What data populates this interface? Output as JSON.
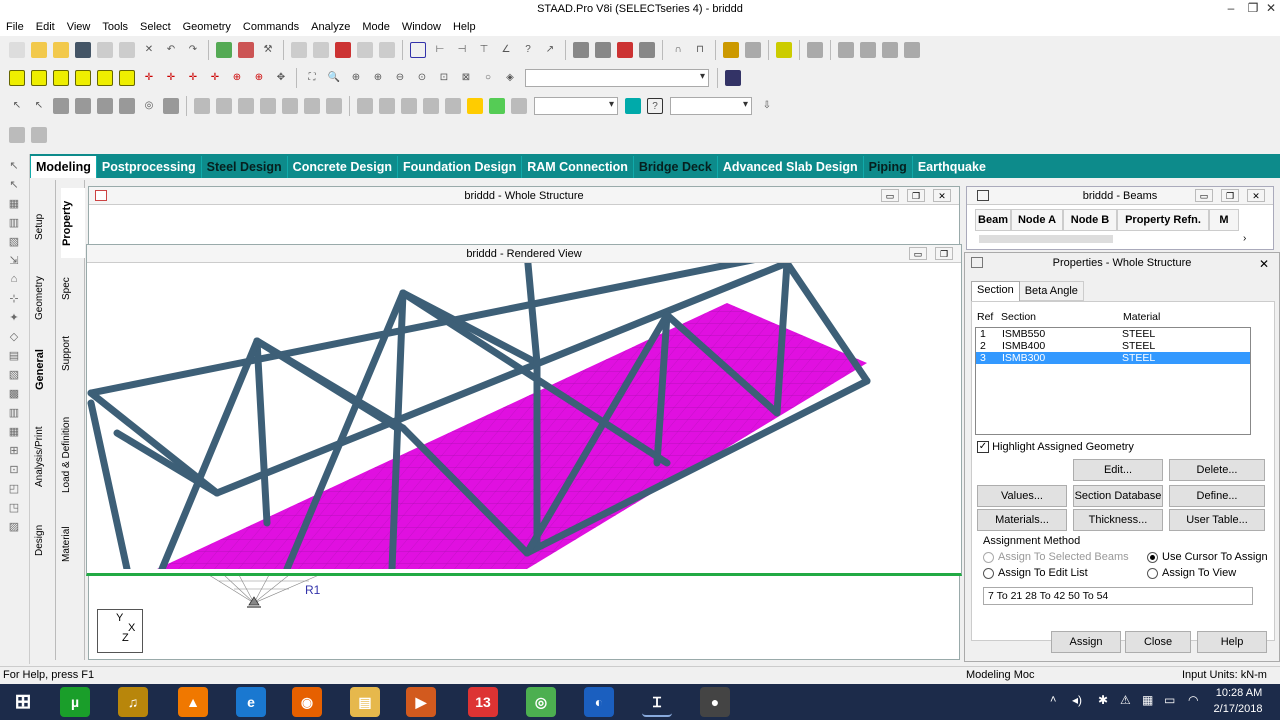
{
  "window": {
    "title": "STAAD.Pro V8i (SELECTseries 4) - briddd"
  },
  "menu": [
    "File",
    "Edit",
    "View",
    "Tools",
    "Select",
    "Geometry",
    "Commands",
    "Analyze",
    "Mode",
    "Window",
    "Help"
  ],
  "page_tabs": [
    "Modeling",
    "Postprocessing",
    "Steel Design",
    "Concrete Design",
    "Foundation Design",
    "RAM Connection",
    "Bridge Deck",
    "Advanced Slab Design",
    "Piping",
    "Earthquake"
  ],
  "side_tabs_outer": [
    "Setup",
    "Geometry",
    "General",
    "Analysis/Print",
    "Design"
  ],
  "side_tabs_inner": [
    "Property",
    "Spec",
    "Support",
    "Load & Definition",
    "Material"
  ],
  "whole_structure": {
    "title": "briddd - Whole Structure",
    "node_label": "R1",
    "axes": {
      "y": "Y",
      "x": "X",
      "z": "Z"
    }
  },
  "rendered_view": {
    "title": "briddd - Rendered View"
  },
  "beams_table": {
    "title": "briddd - Beams",
    "columns": [
      "Beam",
      "Node A",
      "Node B",
      "Property Refn.",
      "M"
    ]
  },
  "properties": {
    "title": "Properties - Whole Structure",
    "tabs": [
      "Section",
      "Beta Angle"
    ],
    "list_headers": {
      "ref": "Ref",
      "section": "Section",
      "material": "Material"
    },
    "rows": [
      {
        "ref": "1",
        "section": "ISMB550",
        "material": "STEEL"
      },
      {
        "ref": "2",
        "section": "ISMB400",
        "material": "STEEL"
      },
      {
        "ref": "3",
        "section": "ISMB300",
        "material": "STEEL"
      }
    ],
    "highlight_label": "Highlight Assigned Geometry",
    "buttons": {
      "edit": "Edit...",
      "delete": "Delete...",
      "values": "Values...",
      "section_db": "Section Database",
      "define": "Define...",
      "materials": "Materials...",
      "thickness": "Thickness...",
      "user_table": "User Table...",
      "assign": "Assign",
      "close": "Close",
      "help": "Help"
    },
    "assignment": {
      "group_label": "Assignment Method",
      "to_selected": "Assign To Selected Beams",
      "use_cursor": "Use Cursor To Assign",
      "to_edit_list": "Assign To Edit List",
      "to_view": "Assign To View",
      "edit_list_value": "7 To 21 28 To 42 50 To 54"
    }
  },
  "status": {
    "help": "For Help, press F1",
    "mode": "Modeling Moc",
    "units": "Input Units:  kN-m"
  },
  "clock": {
    "time": "10:28 AM",
    "date": "2/17/2018"
  },
  "colors": {
    "tabbar": "#0d8b8b",
    "deck": "#e010e0",
    "member": "#3d5f77",
    "select": "#3399ff"
  }
}
